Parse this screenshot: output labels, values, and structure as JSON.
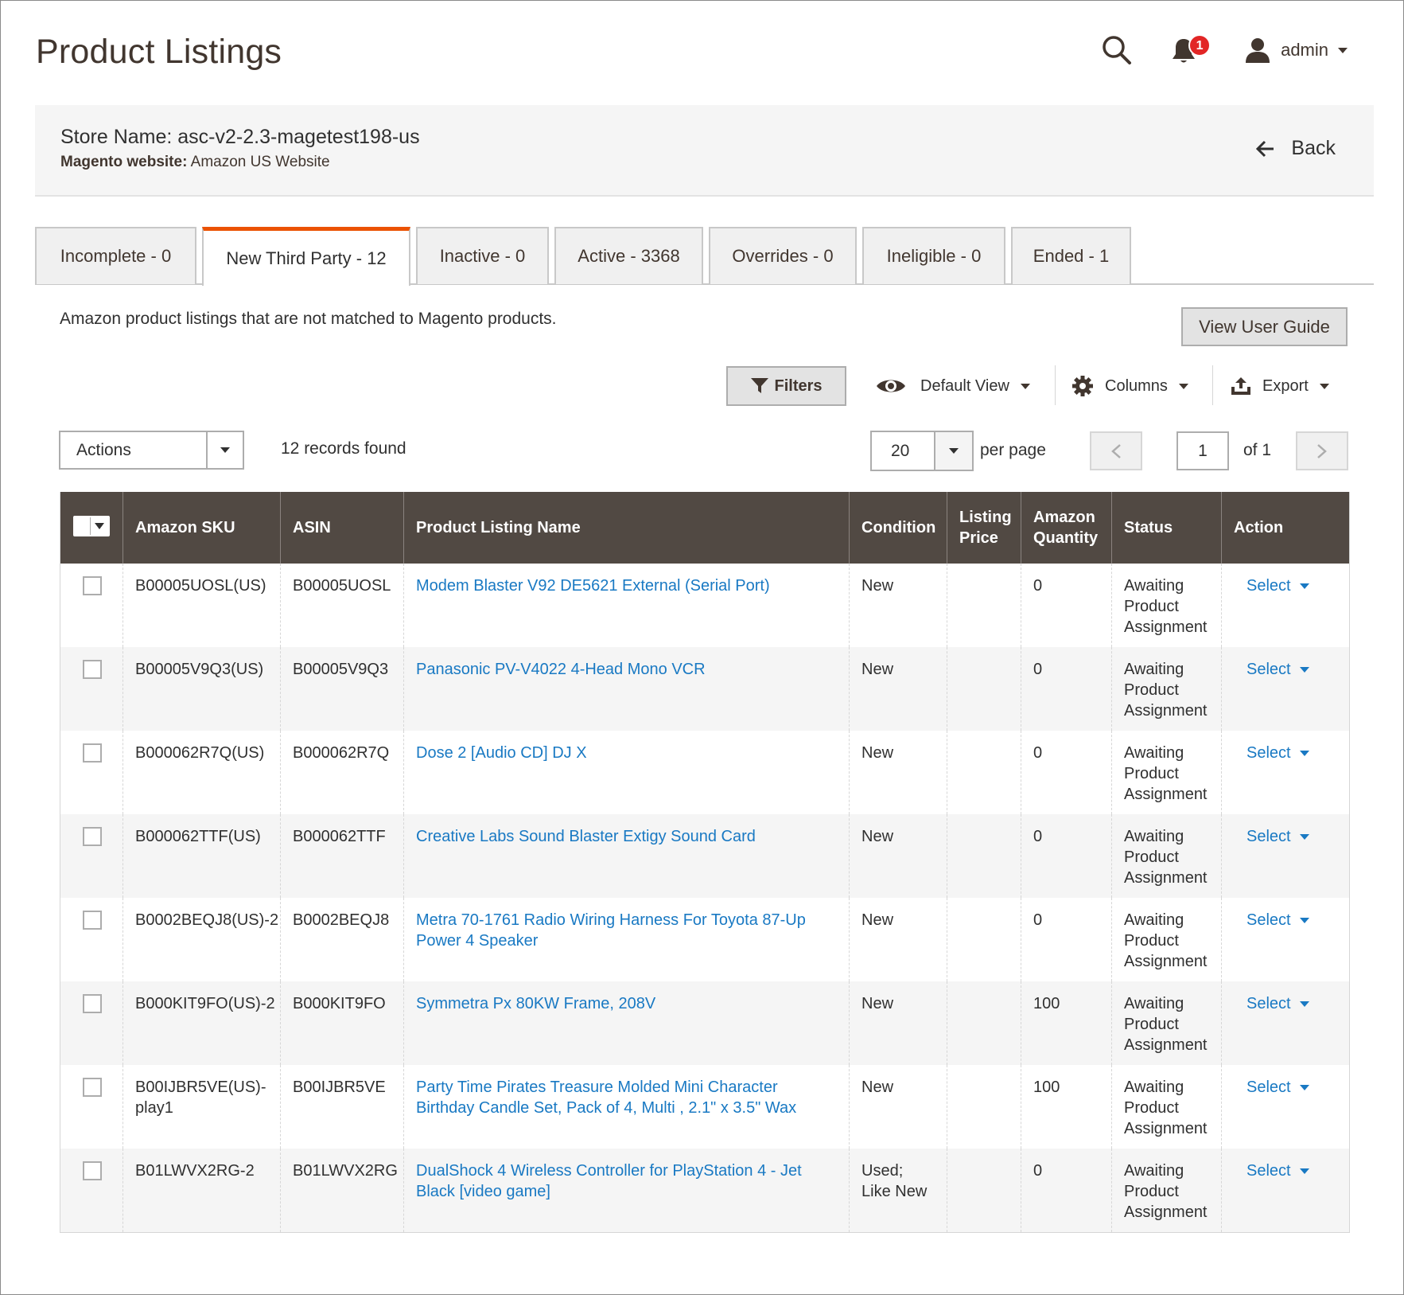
{
  "header": {
    "title": "Product Listings",
    "notification_count": "1",
    "user_name": "admin"
  },
  "store": {
    "name": "Store Name: asc-v2-2.3-magetest198-us",
    "website_label": "Magento website:",
    "website_value": "Amazon US Website",
    "back_label": "Back"
  },
  "tabs": [
    {
      "label": "Incomplete - 0",
      "active": false
    },
    {
      "label": "New Third Party - 12",
      "active": true
    },
    {
      "label": "Inactive - 0",
      "active": false
    },
    {
      "label": "Active - 3368",
      "active": false
    },
    {
      "label": "Overrides - 0",
      "active": false
    },
    {
      "label": "Ineligible - 0",
      "active": false
    },
    {
      "label": "Ended - 1",
      "active": false
    }
  ],
  "description": "Amazon product listings that are not matched to Magento products.",
  "view_user_guide_label": "View User Guide",
  "toolbar": {
    "filters_label": "Filters",
    "view_label": "Default View",
    "columns_label": "Columns",
    "export_label": "Export",
    "actions_label": "Actions",
    "records_found": "12 records found",
    "per_page_value": "20",
    "per_page_label": "per page",
    "current_page": "1",
    "total_pages_label": "of 1"
  },
  "colors": {
    "accent": "#eb5202",
    "link": "#1979c3",
    "table_header": "#514943",
    "badge": "#e22626"
  },
  "table": {
    "columns": [
      "Amazon SKU",
      "ASIN",
      "Product Listing Name",
      "Condition",
      "Listing Price",
      "Amazon Quantity",
      "Status",
      "Action"
    ],
    "rows": [
      {
        "sku": "B00005UOSL(US)",
        "asin": "B00005UOSL",
        "name": "Modem Blaster V92 DE5621 External (Serial Port)",
        "condition": "New",
        "price": "",
        "qty": "0",
        "status": "Awaiting Product Assignment",
        "action": "Select"
      },
      {
        "sku": "B00005V9Q3(US)",
        "asin": "B00005V9Q3",
        "name": "Panasonic PV-V4022 4-Head Mono VCR",
        "condition": "New",
        "price": "",
        "qty": "0",
        "status": "Awaiting Product Assignment",
        "action": "Select"
      },
      {
        "sku": "B000062R7Q(US)",
        "asin": "B000062R7Q",
        "name": "Dose 2 [Audio CD] DJ X",
        "condition": "New",
        "price": "",
        "qty": "0",
        "status": "Awaiting Product Assignment",
        "action": "Select"
      },
      {
        "sku": "B000062TTF(US)",
        "asin": "B000062TTF",
        "name": "Creative Labs Sound Blaster Extigy Sound Card",
        "condition": "New",
        "price": "",
        "qty": "0",
        "status": "Awaiting Product Assignment",
        "action": "Select"
      },
      {
        "sku": "B0002BEQJ8(US)-2",
        "asin": "B0002BEQJ8",
        "name": "Metra 70-1761 Radio Wiring Harness For Toyota 87-Up Power 4 Speaker",
        "condition": "New",
        "price": "",
        "qty": "0",
        "status": "Awaiting Product Assignment",
        "action": "Select"
      },
      {
        "sku": "B000KIT9FO(US)-2",
        "asin": "B000KIT9FO",
        "name": "Symmetra Px 80KW Frame, 208V",
        "condition": "New",
        "price": "",
        "qty": "100",
        "status": "Awaiting Product Assignment",
        "action": "Select"
      },
      {
        "sku": "B00IJBR5VE(US)-play1",
        "asin": "B00IJBR5VE",
        "name": "Party Time Pirates Treasure Molded Mini Character Birthday Candle Set, Pack of 4, Multi , 2.1\" x 3.5\" Wax",
        "condition": "New",
        "price": "",
        "qty": "100",
        "status": "Awaiting Product Assignment",
        "action": "Select"
      },
      {
        "sku": "B01LWVX2RG-2",
        "asin": "B01LWVX2RG",
        "name": "DualShock 4 Wireless Controller for PlayStation 4 - Jet Black [video game]",
        "condition": "Used; Like New",
        "price": "",
        "qty": "0",
        "status": "Awaiting Product Assignment",
        "action": "Select"
      }
    ]
  }
}
